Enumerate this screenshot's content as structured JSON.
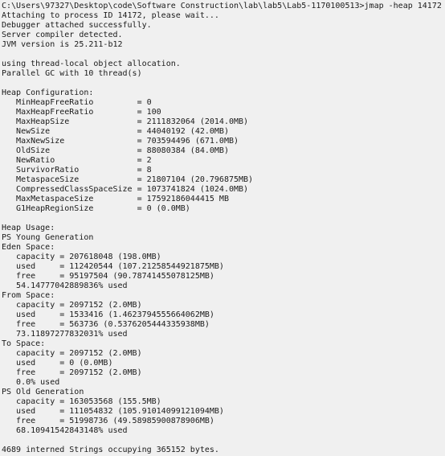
{
  "window": {
    "type": "windows-command-prompt",
    "background_color": "#f0f0f0",
    "text_color": "#1a1a1a"
  },
  "prompt": {
    "path": "C:\\Users\\97327\\Desktop\\code\\Software Construction\\lab\\lab5\\Lab5-1170100513",
    "separator": ">",
    "command": "jmap -heap 14172",
    "full_line": "C:\\Users\\97327\\Desktop\\code\\Software Construction\\lab\\lab5\\Lab5-1170100513>jmap -heap 14172"
  },
  "terminal": {
    "lines": [
      "C:\\Users\\97327\\Desktop\\code\\Software Construction\\lab\\lab5\\Lab5-1170100513>jmap -heap 14172",
      "Attaching to process ID 14172, please wait...",
      "Debugger attached successfully.",
      "Server compiler detected.",
      "JVM version is 25.211-b12",
      "",
      "using thread-local object allocation.",
      "Parallel GC with 10 thread(s)",
      "",
      "Heap Configuration:",
      "   MinHeapFreeRatio         = 0",
      "   MaxHeapFreeRatio         = 100",
      "   MaxHeapSize              = 2111832064 (2014.0MB)",
      "   NewSize                  = 44040192 (42.0MB)",
      "   MaxNewSize               = 703594496 (671.0MB)",
      "   OldSize                  = 88080384 (84.0MB)",
      "   NewRatio                 = 2",
      "   SurvivorRatio            = 8",
      "   MetaspaceSize            = 21807104 (20.796875MB)",
      "   CompressedClassSpaceSize = 1073741824 (1024.0MB)",
      "   MaxMetaspaceSize         = 17592186044415 MB",
      "   G1HeapRegionSize         = 0 (0.0MB)",
      "",
      "Heap Usage:",
      "PS Young Generation",
      "Eden Space:",
      "   capacity = 207618048 (198.0MB)",
      "   used     = 112420544 (107.21258544921875MB)",
      "   free     = 95197504 (90.78741455078125MB)",
      "   54.14777042889836% used",
      "From Space:",
      "   capacity = 2097152 (2.0MB)",
      "   used     = 1533416 (1.4623794555664062MB)",
      "   free     = 563736 (0.5376205444335938MB)",
      "   73.11897277832031% used",
      "To Space:",
      "   capacity = 2097152 (2.0MB)",
      "   used     = 0 (0.0MB)",
      "   free     = 2097152 (2.0MB)",
      "   0.0% used",
      "PS Old Generation",
      "   capacity = 163053568 (155.5MB)",
      "   used     = 111054832 (105.91014099121094MB)",
      "   free     = 51998736 (49.58985900878906MB)",
      "   68.10941542843148% used",
      "",
      "4689 interned Strings occupying 365152 bytes."
    ]
  },
  "jvm_info": {
    "process_id": "14172",
    "jvm_version": "25.211-b12",
    "allocation": "using thread-local object allocation.",
    "gc": "Parallel GC with 10 thread(s)",
    "compiler": "Server compiler detected.",
    "debugger_status": "Debugger attached successfully.",
    "attaching_message": "Attaching to process ID 14172, please wait..."
  },
  "heap_configuration": {
    "title": "Heap Configuration:",
    "entries": [
      {
        "name": "MinHeapFreeRatio",
        "value": "0"
      },
      {
        "name": "MaxHeapFreeRatio",
        "value": "100"
      },
      {
        "name": "MaxHeapSize",
        "value": "2111832064 (2014.0MB)"
      },
      {
        "name": "NewSize",
        "value": "44040192 (42.0MB)"
      },
      {
        "name": "MaxNewSize",
        "value": "703594496 (671.0MB)"
      },
      {
        "name": "OldSize",
        "value": "88080384 (84.0MB)"
      },
      {
        "name": "NewRatio",
        "value": "2"
      },
      {
        "name": "SurvivorRatio",
        "value": "8"
      },
      {
        "name": "MetaspaceSize",
        "value": "21807104 (20.796875MB)"
      },
      {
        "name": "CompressedClassSpaceSize",
        "value": "1073741824 (1024.0MB)"
      },
      {
        "name": "MaxMetaspaceSize",
        "value": "17592186044415 MB"
      },
      {
        "name": "G1HeapRegionSize",
        "value": "0 (0.0MB)"
      }
    ]
  },
  "heap_usage": {
    "title": "Heap Usage:",
    "generations": [
      {
        "name": "PS Young Generation",
        "spaces": [
          {
            "name": "Eden Space:",
            "capacity": "207618048 (198.0MB)",
            "used": "112420544 (107.21258544921875MB)",
            "free": "95197504 (90.78741455078125MB)",
            "percent_used": "54.14777042889836% used"
          },
          {
            "name": "From Space:",
            "capacity": "2097152 (2.0MB)",
            "used": "1533416 (1.4623794555664062MB)",
            "free": "563736 (0.5376205444335938MB)",
            "percent_used": "73.11897277832031% used"
          },
          {
            "name": "To Space:",
            "capacity": "2097152 (2.0MB)",
            "used": "0 (0.0MB)",
            "free": "2097152 (2.0MB)",
            "percent_used": "0.0% used"
          }
        ]
      },
      {
        "name": "PS Old Generation",
        "spaces": [
          {
            "name": "",
            "capacity": "163053568 (155.5MB)",
            "used": "111054832 (105.91014099121094MB)",
            "free": "51998736 (49.58985900878906MB)",
            "percent_used": "68.10941542843148% used"
          }
        ]
      }
    ]
  },
  "footer": {
    "interned_strings": "4689 interned Strings occupying 365152 bytes.",
    "count": "4689",
    "bytes": "365152"
  }
}
